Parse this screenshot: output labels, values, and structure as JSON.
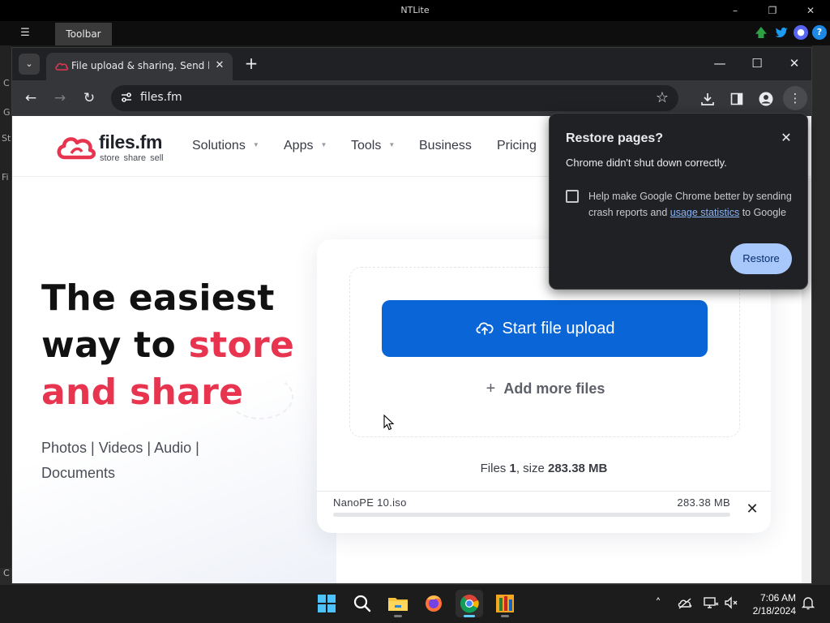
{
  "host_app": {
    "title": "NTLite",
    "toolbar_tab": "Toolbar",
    "left_glyphs": [
      "C",
      "G",
      "St",
      "Fi"
    ],
    "bottom_glyph": "C",
    "colors": {
      "update_arrow": "#2ea043",
      "twitter": "#1d9bf0",
      "discord": "#5865f2",
      "help": "#1e88e5"
    }
  },
  "browser": {
    "tab": {
      "title": "File upload & sharing. Send large files",
      "favicon": "files-fm-logo-icon"
    },
    "new_tab_symbol": "+",
    "url": "files.fm"
  },
  "site": {
    "logo": {
      "name": "files.fm",
      "tagline": "store share sell"
    },
    "nav": [
      {
        "label": "Solutions",
        "has_dropdown": true
      },
      {
        "label": "Apps",
        "has_dropdown": true
      },
      {
        "label": "Tools",
        "has_dropdown": true
      },
      {
        "label": "Business",
        "has_dropdown": false
      },
      {
        "label": "Pricing",
        "has_dropdown": false
      }
    ],
    "hero": {
      "line1": "The easiest",
      "line2_plain": "way to ",
      "line2_accent": "store",
      "line3_accent": "and share",
      "links_line1": "Photos | Videos | Audio |",
      "links_line2": "Documents"
    },
    "upload": {
      "start_button": "Start file upload",
      "add_more": "Add more files",
      "summary_prefix": "Files ",
      "file_count": "1",
      "summary_mid": ", size ",
      "total_size": "283.38 MB",
      "files": [
        {
          "name": "NanoPE 10.iso",
          "size": "283.38 MB",
          "progress": 0
        }
      ]
    },
    "colors": {
      "accent_red": "#e8344e",
      "primary_blue": "#0a66d6"
    }
  },
  "restore_dialog": {
    "title": "Restore pages?",
    "message": "Chrome didn't shut down correctly.",
    "checkbox_text_before": "Help make Google Chrome better by sending crash reports and ",
    "checkbox_link": "usage statistics",
    "checkbox_text_after": " to Google",
    "checkbox_checked": false,
    "button": "Restore"
  },
  "taskbar": {
    "apps": [
      "windows-start-icon",
      "search-icon",
      "file-explorer-icon",
      "firefox-icon",
      "chrome-icon",
      "ntlite-icon"
    ],
    "active_app": "chrome-icon",
    "time": "7:06 AM",
    "date": "2/18/2024"
  }
}
